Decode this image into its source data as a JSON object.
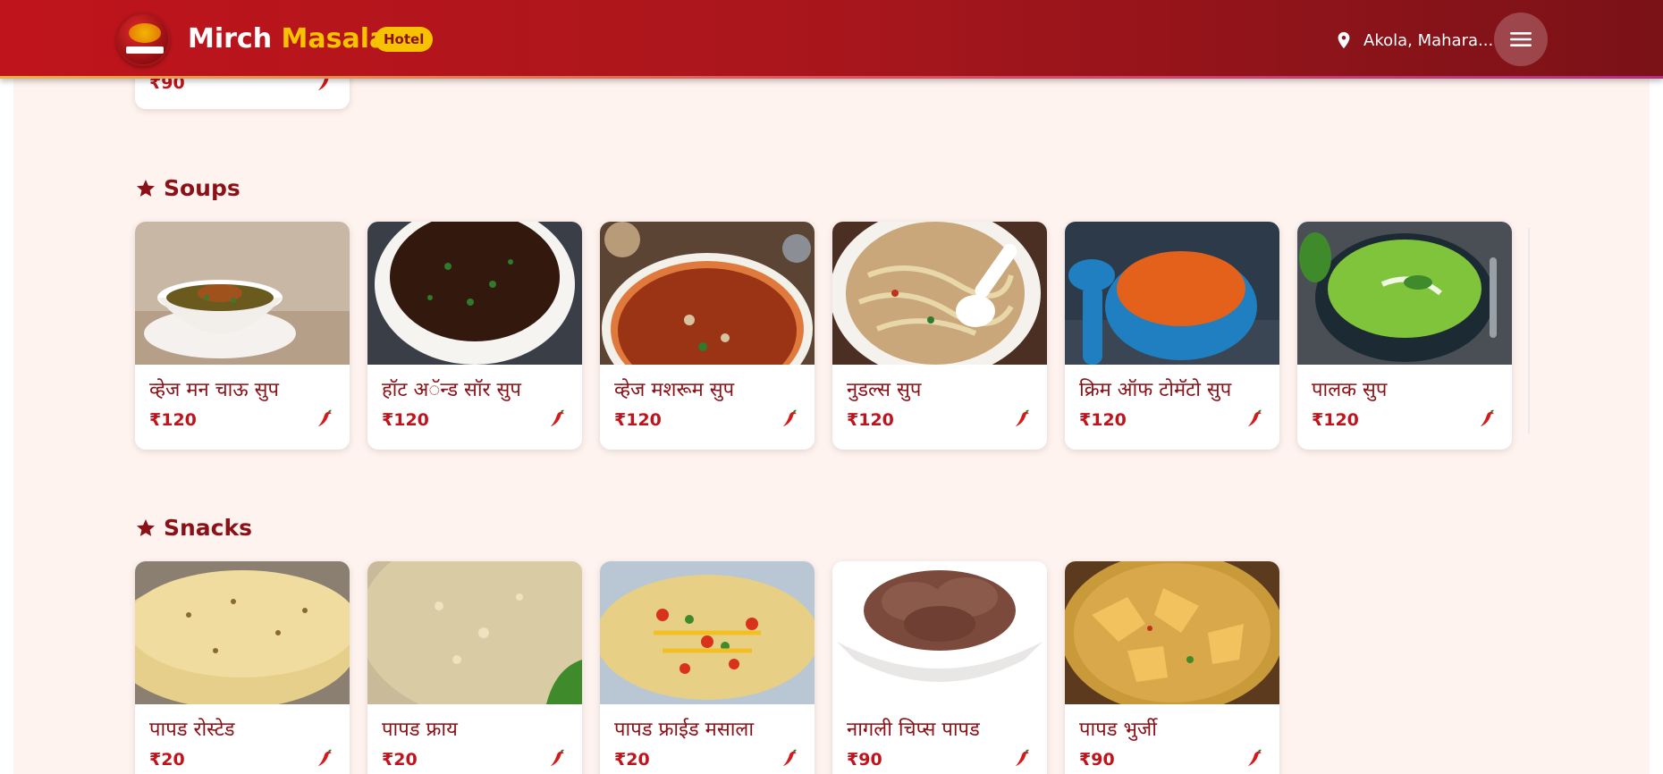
{
  "header": {
    "brand_first": "Mirch",
    "brand_second": "Masala",
    "badge": "Hotel",
    "location": "Akola, Mahara...",
    "icons": {
      "location": "map-pin-icon",
      "menu": "hamburger-menu-icon"
    },
    "colors": {
      "primary": "#c0141c",
      "accent": "#f7c300",
      "dark": "#8a1117"
    }
  },
  "partial_item": {
    "price": "₹90"
  },
  "soups": {
    "title": "Soups",
    "items": [
      {
        "name": "व्हेज मन चाऊ सुप",
        "price": "₹120"
      },
      {
        "name": "हॉट अॅन्ड सॉर सुप",
        "price": "₹120"
      },
      {
        "name": "व्हेज मशरूम सुप",
        "price": "₹120"
      },
      {
        "name": "नुडल्स सुप",
        "price": "₹120"
      },
      {
        "name": "क्रिम ऑफ टोमॅटो सुप",
        "price": "₹120"
      },
      {
        "name": "पालक सुप",
        "price": "₹120"
      }
    ]
  },
  "snacks": {
    "title": "Snacks",
    "items": [
      {
        "name": "पापड रोस्टेड",
        "price": "₹20"
      },
      {
        "name": "पापड फ्राय",
        "price": "₹20"
      },
      {
        "name": "पापड फ्राईड मसाला",
        "price": "₹20"
      },
      {
        "name": "नागली चिप्स पापड",
        "price": "₹90"
      },
      {
        "name": "पापड भुर्जी",
        "price": "₹90"
      }
    ]
  }
}
